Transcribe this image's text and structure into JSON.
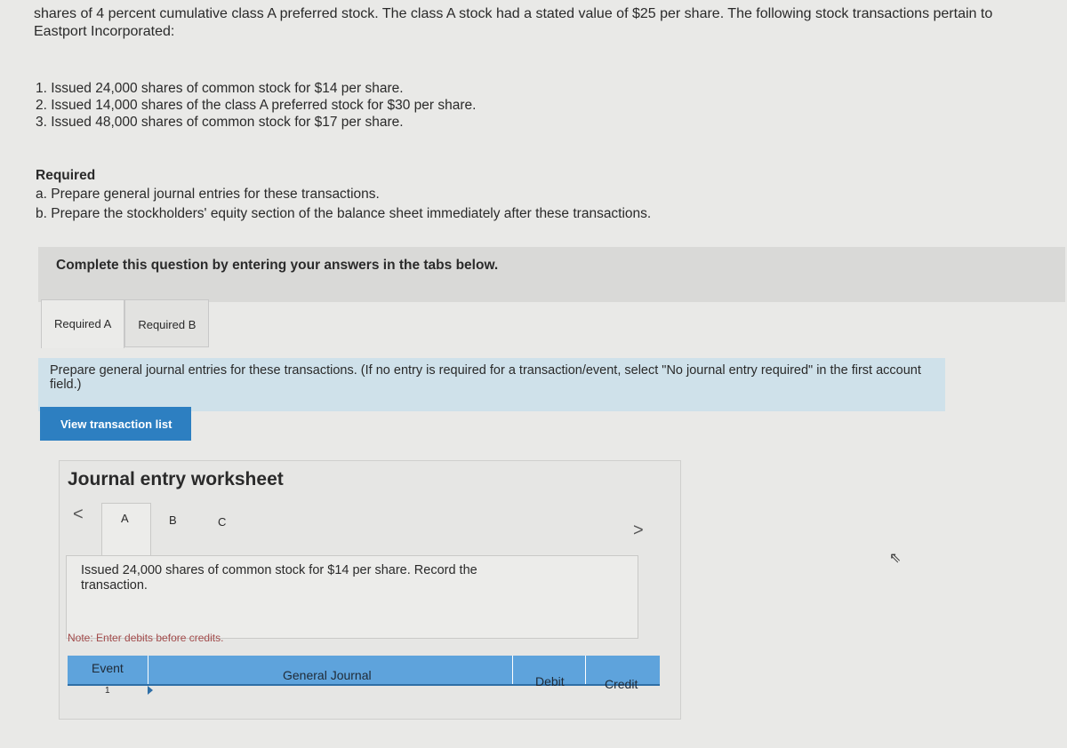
{
  "intro": "shares of 4 percent cumulative class A preferred stock. The class A stock had a stated value of $25 per share. The following stock transactions pertain to Eastport Incorporated:",
  "transactions": [
    "1. Issued 24,000 shares of common stock for $14 per share.",
    "2. Issued 14,000 shares of the class A preferred stock for $30 per share.",
    "3. Issued 48,000 shares of common stock for $17 per share."
  ],
  "required": {
    "heading": "Required",
    "items": [
      "a. Prepare general journal entries for these transactions.",
      "b. Prepare the stockholders' equity section of the balance sheet immediately after these transactions."
    ]
  },
  "banner": "Complete this question by entering your answers in the tabs below.",
  "tabs": [
    {
      "label": "Required A",
      "active": true
    },
    {
      "label": "Required B",
      "active": false
    }
  ],
  "instruction": "Prepare general journal entries for these transactions. (If no entry is required for a transaction/event, select \"No journal entry required\" in the first account field.)",
  "view_button": "View transaction list",
  "worksheet": {
    "title": "Journal entry worksheet",
    "prev": "<",
    "next": ">",
    "tabs": [
      "A",
      "B",
      "C"
    ],
    "description": "Issued 24,000 shares of common stock for $14 per share. Record the transaction.",
    "note": "Note: Enter debits before credits.",
    "columns": [
      "Event",
      "General Journal",
      "Debit",
      "Credit"
    ],
    "rows": [
      {
        "event": "1"
      }
    ]
  },
  "colors": {
    "accent": "#2d7fc1",
    "table_header": "#5ea3dc",
    "instruction_bg": "#cfe1ea",
    "note": "#a24b4b"
  }
}
